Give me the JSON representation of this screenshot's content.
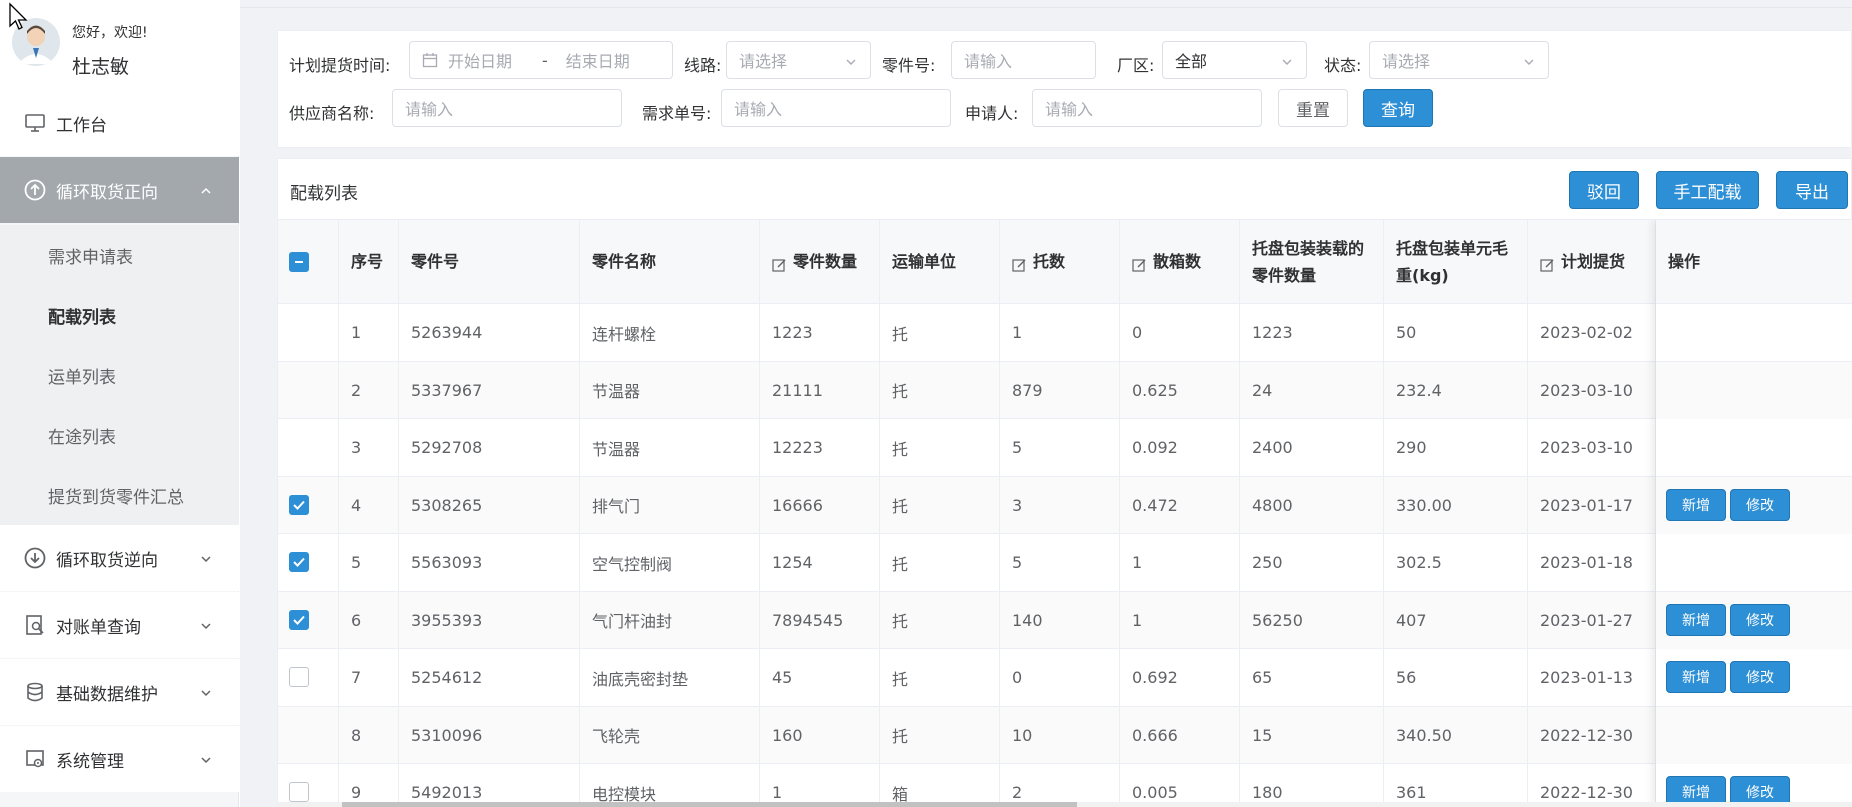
{
  "user": {
    "greeting": "您好，欢迎!",
    "name": "杜志敏"
  },
  "sidebar": {
    "workbench": "工作台",
    "forward_group": "循环取货正向",
    "sub_items": [
      "需求申请表",
      "配载列表",
      "运单列表",
      "在途列表",
      "提货到货零件汇总"
    ],
    "active_sub": "配载列表",
    "reverse_group": "循环取货逆向",
    "statement_query": "对账单查询",
    "basic_data": "基础数据维护",
    "system_admin": "系统管理"
  },
  "filters": {
    "plan_time_label": "计划提货时间:",
    "start_date_placeholder": "开始日期",
    "date_separator": "-",
    "end_date_placeholder": "结束日期",
    "route_label": "线路:",
    "route_placeholder": "请选择",
    "part_no_label": "零件号:",
    "part_no_placeholder": "请输入",
    "plant_label": "厂区:",
    "plant_value": "全部",
    "status_label": "状态:",
    "status_placeholder": "请选择",
    "supplier_label": "供应商名称:",
    "supplier_placeholder": "请输入",
    "demand_no_label": "需求单号:",
    "demand_no_placeholder": "请输入",
    "applicant_label": "申请人:",
    "applicant_placeholder": "请输入",
    "reset_button": "重置",
    "query_button": "查询"
  },
  "list": {
    "title": "配载列表",
    "reject_button": "驳回",
    "manual_button": "手工配载",
    "export_button": "导出"
  },
  "table": {
    "headers": {
      "index": "序号",
      "part_no": "零件号",
      "part_name": "零件名称",
      "quantity": "零件数量",
      "unit": "运输单位",
      "pallets": "托数",
      "loose": "散箱数",
      "pallet_qty": "托盘包装装载的零件数量",
      "pallet_weight": "托盘包装单元毛重(kg)",
      "plan_date": "计划提货",
      "actions": "操作"
    },
    "add_label": "新增",
    "edit_label": "修改",
    "rows": [
      {
        "index": "1",
        "part_no": "5263944",
        "part_name": "连杆螺栓",
        "quantity": "1223",
        "unit": "托",
        "pallets": "1",
        "loose": "0",
        "pallet_qty": "1223",
        "pallet_weight": "50",
        "plan_date": "2023-02-02",
        "checkbox": "none",
        "actions": false
      },
      {
        "index": "2",
        "part_no": "5337967",
        "part_name": "节温器",
        "quantity": "21111",
        "unit": "托",
        "pallets": "879",
        "loose": "0.625",
        "pallet_qty": "24",
        "pallet_weight": "232.4",
        "plan_date": "2023-03-10",
        "checkbox": "none",
        "actions": false
      },
      {
        "index": "3",
        "part_no": "5292708",
        "part_name": "节温器",
        "quantity": "12223",
        "unit": "托",
        "pallets": "5",
        "loose": "0.092",
        "pallet_qty": "2400",
        "pallet_weight": "290",
        "plan_date": "2023-03-10",
        "checkbox": "none",
        "actions": false
      },
      {
        "index": "4",
        "part_no": "5308265",
        "part_name": "排气门",
        "quantity": "16666",
        "unit": "托",
        "pallets": "3",
        "loose": "0.472",
        "pallet_qty": "4800",
        "pallet_weight": "330.00",
        "plan_date": "2023-01-17",
        "checkbox": "checked",
        "actions": true
      },
      {
        "index": "5",
        "part_no": "5563093",
        "part_name": "空气控制阀",
        "quantity": "1254",
        "unit": "托",
        "pallets": "5",
        "loose": "1",
        "pallet_qty": "250",
        "pallet_weight": "302.5",
        "plan_date": "2023-01-18",
        "checkbox": "checked",
        "actions": false
      },
      {
        "index": "6",
        "part_no": "3955393",
        "part_name": "气门杆油封",
        "quantity": "7894545",
        "unit": "托",
        "pallets": "140",
        "loose": "1",
        "pallet_qty": "56250",
        "pallet_weight": "407",
        "plan_date": "2023-01-27",
        "checkbox": "checked",
        "actions": true
      },
      {
        "index": "7",
        "part_no": "5254612",
        "part_name": "油底壳密封垫",
        "quantity": "45",
        "unit": "托",
        "pallets": "0",
        "loose": "0.692",
        "pallet_qty": "65",
        "pallet_weight": "56",
        "plan_date": "2023-01-13",
        "checkbox": "unchecked",
        "actions": true
      },
      {
        "index": "8",
        "part_no": "5310096",
        "part_name": "飞轮壳",
        "quantity": "160",
        "unit": "托",
        "pallets": "10",
        "loose": "0.666",
        "pallet_qty": "15",
        "pallet_weight": "340.50",
        "plan_date": "2022-12-30",
        "checkbox": "none",
        "actions": false
      },
      {
        "index": "9",
        "part_no": "5492013",
        "part_name": "电控模块",
        "quantity": "1",
        "unit": "箱",
        "pallets": "2",
        "loose": "0.005",
        "pallet_qty": "180",
        "pallet_weight": "361",
        "plan_date": "2022-12-30",
        "checkbox": "unchecked",
        "actions": true
      }
    ]
  },
  "colors": {
    "primary": "#2d8fd5",
    "active_menu": "#a3a8ad"
  }
}
